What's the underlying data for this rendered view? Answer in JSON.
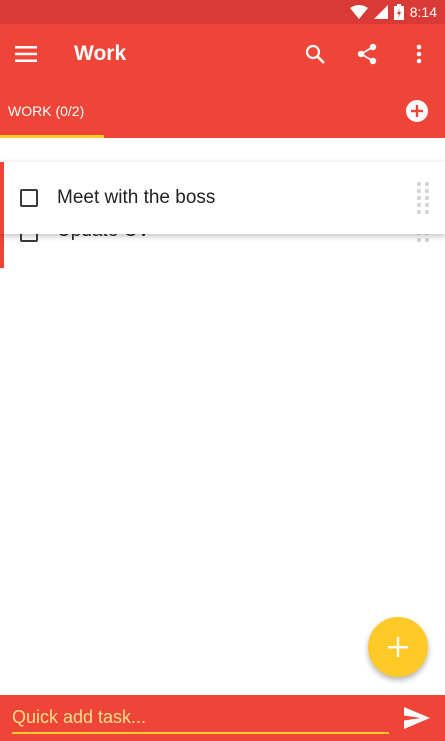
{
  "status_bar": {
    "time": "8:14",
    "icons": [
      "wifi-icon",
      "signal-icon",
      "battery-icon"
    ]
  },
  "app_bar": {
    "title": "Work",
    "icons": [
      "menu-icon",
      "search-icon",
      "share-icon",
      "more-vert-icon"
    ]
  },
  "tabs": {
    "active_label": "WORK (0/2)",
    "add_icon": "add-circle-icon"
  },
  "tasks": [
    {
      "title": "Meet with the boss",
      "checked": false,
      "state": "dragging"
    },
    {
      "title": "Update CV",
      "checked": false,
      "state": "behind"
    }
  ],
  "fab": {
    "icon": "plus-icon"
  },
  "quick_add": {
    "placeholder": "Quick add task...",
    "value": "",
    "send_icon": "send-icon"
  },
  "colors": {
    "primary": "#ef4438",
    "status_bar": "#d93a35",
    "accent": "#ffc928"
  }
}
